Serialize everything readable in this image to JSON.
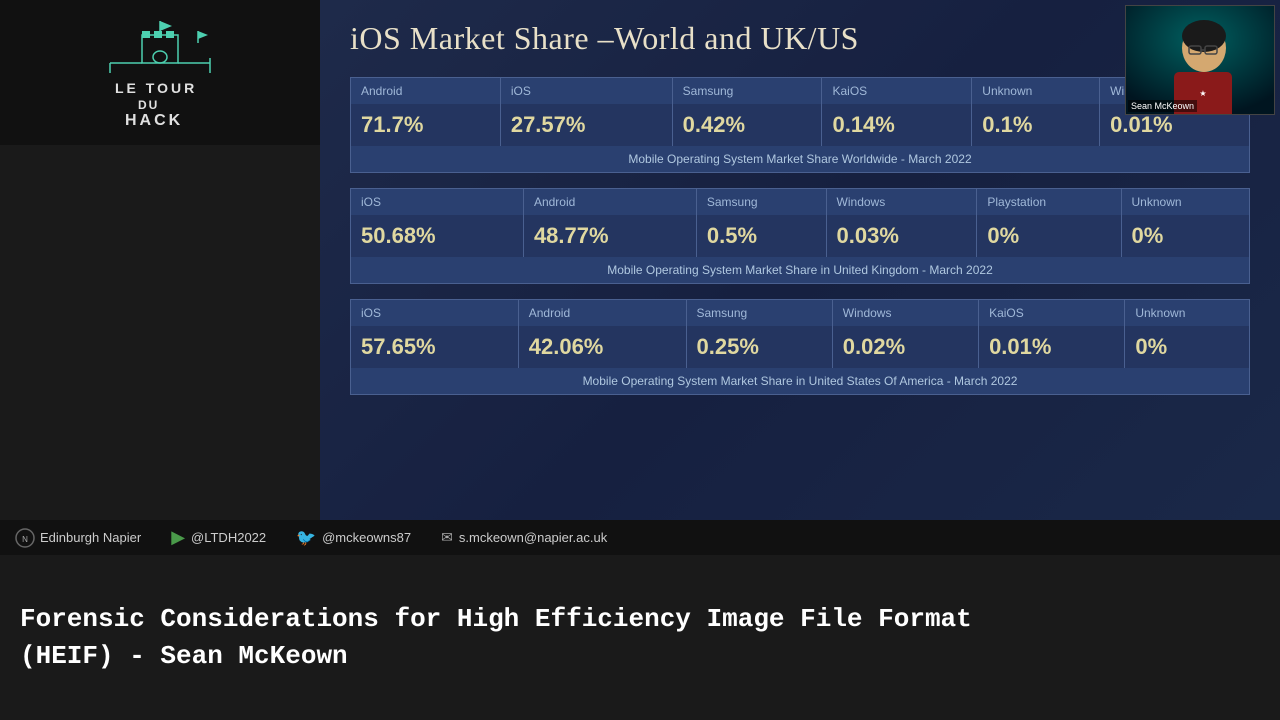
{
  "slide": {
    "title": "iOS Market Share –World and UK/US",
    "table_worldwide": {
      "caption": "Mobile Operating System Market Share Worldwide - March 2022",
      "columns": [
        {
          "label": "Android",
          "value": "71.7%"
        },
        {
          "label": "iOS",
          "value": "27.57%"
        },
        {
          "label": "Samsung",
          "value": "0.42%"
        },
        {
          "label": "KaiOS",
          "value": "0.14%"
        },
        {
          "label": "Unknown",
          "value": "0.1%"
        },
        {
          "label": "Windows",
          "value": "0.01%"
        }
      ]
    },
    "table_uk": {
      "caption": "Mobile Operating System Market Share in United Kingdom - March 2022",
      "columns": [
        {
          "label": "iOS",
          "value": "50.68%"
        },
        {
          "label": "Android",
          "value": "48.77%"
        },
        {
          "label": "Samsung",
          "value": "0.5%"
        },
        {
          "label": "Windows",
          "value": "0.03%"
        },
        {
          "label": "Playstation",
          "value": "0%"
        },
        {
          "label": "Unknown",
          "value": "0%"
        }
      ]
    },
    "table_us": {
      "caption": "Mobile Operating System Market Share in United States Of America - March 2022",
      "columns": [
        {
          "label": "iOS",
          "value": "57.65%"
        },
        {
          "label": "Android",
          "value": "42.06%"
        },
        {
          "label": "Samsung",
          "value": "0.25%"
        },
        {
          "label": "Windows",
          "value": "0.02%"
        },
        {
          "label": "KaiOS",
          "value": "0.01%"
        },
        {
          "label": "Unknown",
          "value": "0%"
        }
      ]
    }
  },
  "bottom_bar": {
    "org": "Edinburgh Napier",
    "hashtag": "@LTDH2022",
    "twitter_handle": "@mckeowns87",
    "email": "s.mckeown@napier.ac.uk",
    "subtitle_line1": "Forensic Considerations for High Efficiency Image File Format",
    "subtitle_line2": "(HEIF) - Sean McKeown"
  },
  "webcam": {
    "speaker_label": "Sean McKeown"
  },
  "logo": {
    "line1": "LE TOUR",
    "line2": "DU",
    "line3": "HACK"
  }
}
